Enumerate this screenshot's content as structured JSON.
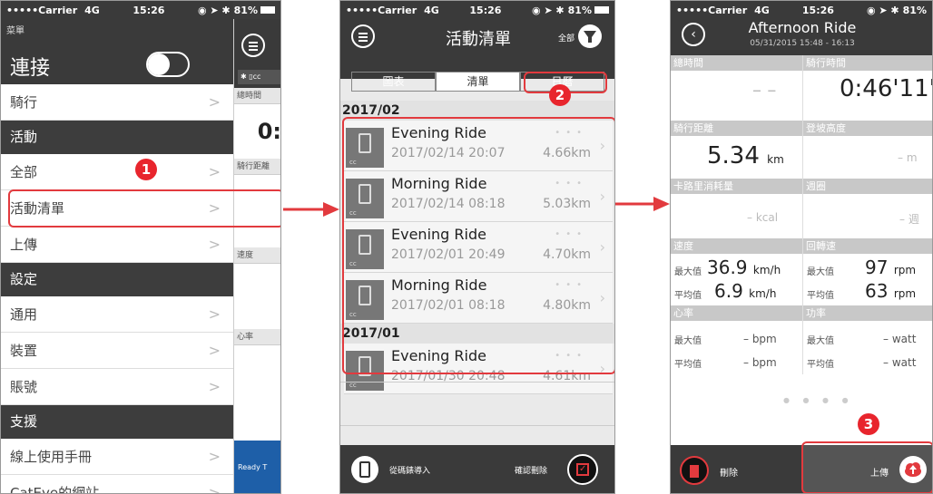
{
  "status_bar": {
    "carrier": "•••••Carrier",
    "network": "4G",
    "time": "15:26",
    "battery": "81%"
  },
  "phone1": {
    "menu_title": "菜單",
    "connect_label": "連接",
    "items": [
      {
        "type": "row",
        "label": "騎行"
      },
      {
        "type": "section",
        "label": "活動"
      },
      {
        "type": "row",
        "label": "全部"
      },
      {
        "type": "row",
        "label": "活動清單"
      },
      {
        "type": "row",
        "label": "上傳"
      },
      {
        "type": "section",
        "label": "設定"
      },
      {
        "type": "row",
        "label": "通用"
      },
      {
        "type": "row",
        "label": "裝置"
      },
      {
        "type": "row",
        "label": "賬號"
      },
      {
        "type": "section",
        "label": "支援"
      },
      {
        "type": "row",
        "label": "線上使用手冊"
      },
      {
        "type": "row",
        "label": "CatEye的網站"
      }
    ],
    "strip": {
      "total_time": "總時間",
      "value_partial": "0:",
      "distance": "騎行距離",
      "speed": "速度",
      "heart_rate": "心率",
      "ready": "Ready T"
    },
    "chevron": ">"
  },
  "phone2": {
    "title": "活動清單",
    "filter_label": "全部",
    "tabs": [
      "圖表",
      "清單",
      "日曆"
    ],
    "groups": [
      {
        "year": "2017/02",
        "rides": [
          {
            "name": "Evening Ride",
            "date": "2017/02/14 20:07",
            "distance": "4.66km"
          },
          {
            "name": "Morning Ride",
            "date": "2017/02/14 08:18",
            "distance": "5.03km"
          },
          {
            "name": "Evening Ride",
            "date": "2017/02/01 20:49",
            "distance": "4.70km"
          },
          {
            "name": "Morning Ride",
            "date": "2017/02/01 08:18",
            "distance": "4.80km"
          }
        ]
      },
      {
        "year": "2017/01",
        "rides": [
          {
            "name": "Evening Ride",
            "date": "2017/01/30 20:48",
            "distance": "4.61km"
          }
        ]
      }
    ],
    "import_label": "從碼錶導入",
    "confirm_delete_label": "確認刪除"
  },
  "phone3": {
    "title": "Afternoon Ride",
    "subtitle": "05/31/2015 15:48 - 16:13",
    "total_time_label": "總時間",
    "total_time_value": "– –",
    "ride_time_label": "騎行時間",
    "ride_time_value": "0:46'11\"",
    "distance_label": "騎行距離",
    "distance_value": "5.34",
    "distance_unit": "km",
    "climb_label": "登坡高度",
    "climb_value": "– m",
    "calories_label": "卡路里消耗量",
    "calories_value": "– kcal",
    "laps_label": "週圈",
    "laps_value": "– 週",
    "speed_label": "速度",
    "cadence_label": "回轉速",
    "max_label": "最大值",
    "avg_label": "平均值",
    "speed_max": "36.9",
    "speed_avg": "6.9",
    "speed_unit": "km/h",
    "cadence_max": "97",
    "cadence_avg": "63",
    "cadence_unit": "rpm",
    "hr_label": "心率",
    "power_label": "功率",
    "hr_max": "–  bpm",
    "hr_avg": "–  bpm",
    "power_max": "–  watt",
    "power_avg": "–  watt",
    "delete_label": "刪除",
    "upload_label": "上傳"
  },
  "callouts": [
    "1",
    "2",
    "3"
  ],
  "colors": {
    "accent_red": "#e23a3e",
    "header_dark": "#3a3a3a",
    "section_grey": "#c8c8c8"
  }
}
